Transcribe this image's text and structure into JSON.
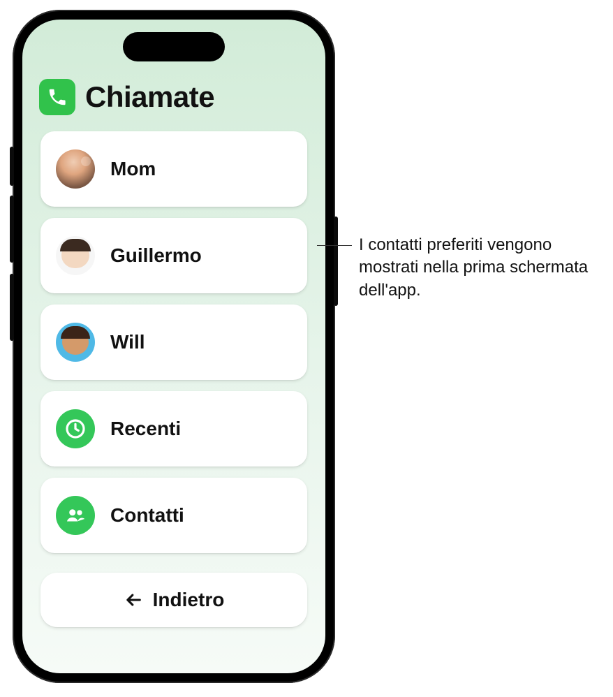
{
  "header": {
    "title": "Chiamate",
    "app_icon": "phone-icon"
  },
  "contacts": [
    {
      "name": "Mom",
      "avatar": "mom",
      "semantic": "contact-mom"
    },
    {
      "name": "Guillermo",
      "avatar": "guillermo",
      "semantic": "contact-guillermo"
    },
    {
      "name": "Will",
      "avatar": "will",
      "semantic": "contact-will"
    }
  ],
  "menu": {
    "recents": {
      "label": "Recenti",
      "icon": "clock-icon"
    },
    "contacts": {
      "label": "Contatti",
      "icon": "people-icon"
    }
  },
  "back_button": {
    "label": "Indietro",
    "icon": "arrow-left-icon"
  },
  "callout": {
    "text": "I contatti preferiti vengono mostrati nella prima schermata dell'app."
  },
  "colors": {
    "accent_green": "#34c759",
    "bg_gradient_top": "#d2ecd8",
    "card_bg": "#ffffff"
  }
}
